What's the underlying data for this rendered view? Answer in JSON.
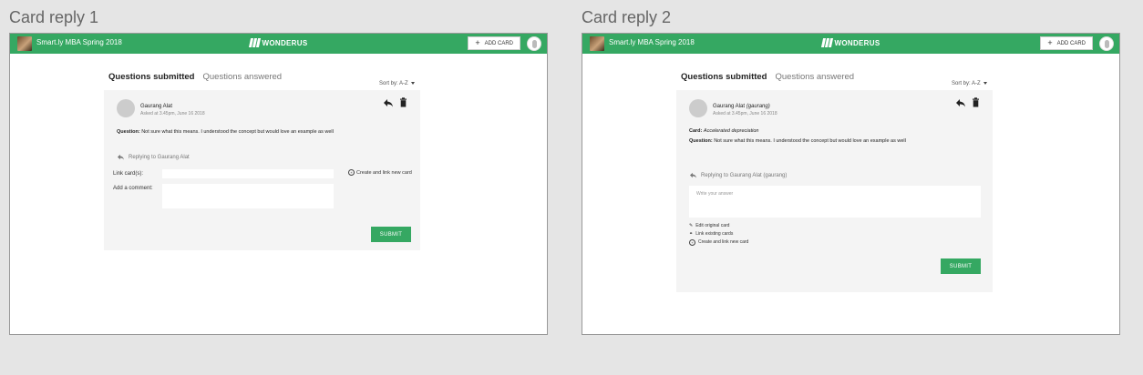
{
  "panels": [
    {
      "title": "Card reply 1",
      "header": {
        "app_name": "Smart.ly MBA Spring 2018",
        "brand": "WONDERUS",
        "add_card": "ADD CARD"
      },
      "tabs": {
        "active": "Questions submitted",
        "inactive": "Questions answered"
      },
      "sort": "Sort by: A-Z",
      "question": {
        "author": "Gaurang Alat",
        "asked": "Asked at 3.45pm, June 16 2018",
        "label": "Question:",
        "text": "Not sure what this means. I understood the concept but would love an example as well"
      },
      "reply": {
        "replying_to": "Replying to Gaurang Alat",
        "link_label": "Link card(s):",
        "comment_label": "Add a comment:",
        "create_link": "Create and link new card",
        "submit": "SUBMIT"
      }
    },
    {
      "title": "Card reply 2",
      "header": {
        "app_name": "Smart.ly MBA Spring 2018",
        "brand": "WONDERUS",
        "add_card": "ADD CARD"
      },
      "tabs": {
        "active": "Questions submitted",
        "inactive": "Questions answered"
      },
      "sort": "Sort by: A-Z",
      "question": {
        "author": "Gaurang Alat",
        "author_handle": "(gaurang)",
        "asked": "Asked at 3.45pm, June 16 2018",
        "card_label": "Card:",
        "card_name": "Accelerated depreciation",
        "label": "Question:",
        "text": "Not sure what this means. I understood the concept but would love an example as well"
      },
      "reply": {
        "replying_to": "Replying to Gaurang Alat (gaurang)",
        "answer_placeholder": "Write your answer",
        "options": [
          "Edit original card",
          "Link existing cards",
          "Create and link new card"
        ],
        "submit": "SUBMIT"
      }
    }
  ]
}
